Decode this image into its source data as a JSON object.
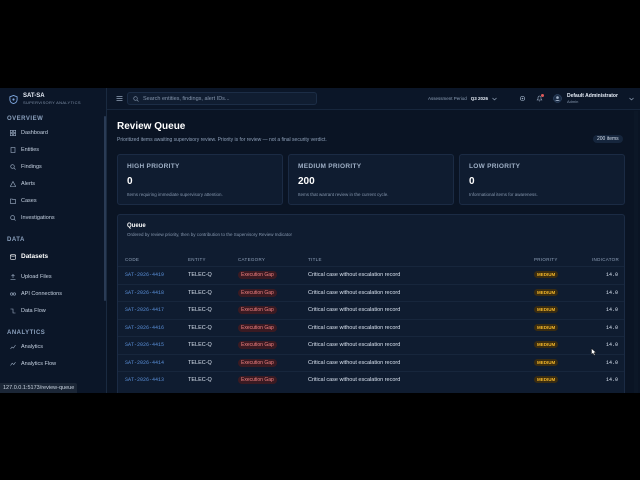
{
  "brand": {
    "name": "SAT-SA",
    "subtitle": "SUPERVISORY ANALYTICS"
  },
  "nav": {
    "overview_heading": "OVERVIEW",
    "overview_items": [
      "Dashboard",
      "Entities",
      "Findings",
      "Alerts",
      "Cases",
      "Investigations"
    ],
    "data_heading": "DATA",
    "data_items": [
      "Datasets",
      "Upload Files",
      "API Connections",
      "Data Flow"
    ],
    "analytics_heading": "ANALYTICS",
    "analytics_items": [
      "Analytics",
      "Analytics Flow"
    ],
    "active": "Datasets"
  },
  "topbar": {
    "search_placeholder": "Search entities, findings, alert IDs...",
    "period_label": "Assessment Period",
    "period_value": "Q3 2026",
    "user_name": "Default Administrator",
    "user_role": "Admin"
  },
  "page": {
    "title": "Review Queue",
    "subtitle": "Prioritized items awaiting supervisory review. Priority is for review — not a final security verdict.",
    "count_badge": "200 items"
  },
  "cards": [
    {
      "label": "HIGH PRIORITY",
      "value": "0",
      "desc": "Items requiring immediate supervisory attention."
    },
    {
      "label": "MEDIUM PRIORITY",
      "value": "200",
      "desc": "Items that warrant review in the current cycle."
    },
    {
      "label": "LOW PRIORITY",
      "value": "0",
      "desc": "Informational items for awareness."
    }
  ],
  "queue": {
    "title": "Queue",
    "subtitle": "Ordered by review priority, then by contribution to the Supervisory Review Indicator",
    "columns": [
      "CODE",
      "ENTITY",
      "CATEGORY",
      "TITLE",
      "PRIORITY",
      "INDICATOR"
    ],
    "rows": [
      {
        "code": "SAT-2026-4419",
        "entity": "TELEC-Q",
        "category": "Execution Gap",
        "title": "Critical case without escalation record",
        "priority": "MEDIUM",
        "indicator": "14.0"
      },
      {
        "code": "SAT-2026-4418",
        "entity": "TELEC-Q",
        "category": "Execution Gap",
        "title": "Critical case without escalation record",
        "priority": "MEDIUM",
        "indicator": "14.0"
      },
      {
        "code": "SAT-2026-4417",
        "entity": "TELEC-Q",
        "category": "Execution Gap",
        "title": "Critical case without escalation record",
        "priority": "MEDIUM",
        "indicator": "14.0"
      },
      {
        "code": "SAT-2026-4416",
        "entity": "TELEC-Q",
        "category": "Execution Gap",
        "title": "Critical case without escalation record",
        "priority": "MEDIUM",
        "indicator": "14.0"
      },
      {
        "code": "SAT-2026-4415",
        "entity": "TELEC-Q",
        "category": "Execution Gap",
        "title": "Critical case without escalation record",
        "priority": "MEDIUM",
        "indicator": "14.0"
      },
      {
        "code": "SAT-2026-4414",
        "entity": "TELEC-Q",
        "category": "Execution Gap",
        "title": "Critical case without escalation record",
        "priority": "MEDIUM",
        "indicator": "14.0"
      },
      {
        "code": "SAT-2026-4413",
        "entity": "TELEC-Q",
        "category": "Execution Gap",
        "title": "Critical case without escalation record",
        "priority": "MEDIUM",
        "indicator": "14.0"
      }
    ]
  },
  "status_url": "127.0.0.1:5173/review-queue",
  "colors": {
    "accent": "#5a8fd8",
    "medium": "#f0b429",
    "category": "#f08080",
    "background": "#0a1424"
  }
}
